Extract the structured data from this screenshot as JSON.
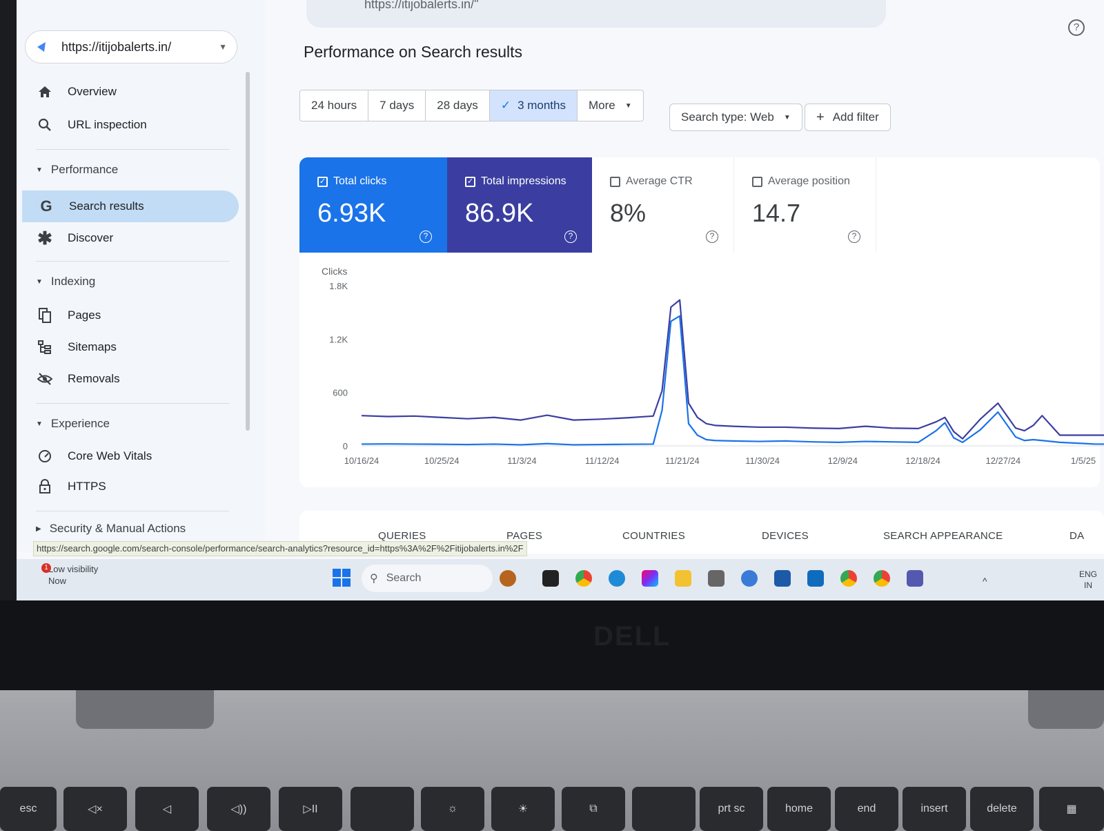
{
  "browser": {
    "address_fragment": "https://itijobalerts.in/\""
  },
  "property": {
    "url": "https://itijobalerts.in/"
  },
  "sidebar": {
    "overview": "Overview",
    "url_inspection": "URL inspection",
    "performance_header": "Performance",
    "search_results": "Search results",
    "discover": "Discover",
    "indexing_header": "Indexing",
    "pages": "Pages",
    "sitemaps": "Sitemaps",
    "removals": "Removals",
    "experience_header": "Experience",
    "core_web_vitals": "Core Web Vitals",
    "https": "HTTPS",
    "security_header": "Security & Manual Actions"
  },
  "main": {
    "title": "Performance on Search results",
    "ranges": [
      "24 hours",
      "7 days",
      "28 days",
      "3 months",
      "More"
    ],
    "selected_range": "3 months",
    "search_type": "Search type: Web",
    "add_filter": "Add filter"
  },
  "metrics": {
    "clicks": {
      "label": "Total clicks",
      "value": "6.93K",
      "checked": true
    },
    "impressions": {
      "label": "Total impressions",
      "value": "86.9K",
      "checked": true
    },
    "ctr": {
      "label": "Average CTR",
      "value": "8%",
      "checked": false
    },
    "position": {
      "label": "Average position",
      "value": "14.7",
      "checked": false
    }
  },
  "chart_data": {
    "type": "line",
    "ylabel": "Clicks",
    "ytick_labels": [
      "0",
      "600",
      "1.2K",
      "1.8K"
    ],
    "ylim": [
      0,
      1800
    ],
    "xtick_labels": [
      "10/16/24",
      "10/25/24",
      "11/3/24",
      "11/12/24",
      "11/21/24",
      "11/30/24",
      "12/9/24",
      "12/18/24",
      "12/27/24",
      "1/5/25"
    ],
    "x": [
      0,
      3,
      6,
      9,
      12,
      15,
      18,
      21,
      24,
      27,
      30,
      33,
      34,
      35,
      36,
      37,
      38,
      39,
      40,
      42,
      45,
      48,
      51,
      54,
      57,
      60,
      63,
      65,
      66,
      67,
      68,
      70,
      72,
      74,
      75,
      76,
      77,
      79,
      81,
      82,
      83,
      84
    ],
    "series": [
      {
        "color": "#3b3ea0",
        "values": [
          340,
          330,
          335,
          320,
          305,
          320,
          290,
          345,
          290,
          300,
          315,
          335,
          620,
          1560,
          1640,
          480,
          320,
          250,
          230,
          220,
          210,
          210,
          200,
          195,
          220,
          200,
          195,
          270,
          320,
          160,
          80,
          300,
          480,
          200,
          170,
          230,
          340,
          120,
          120,
          120,
          120,
          120
        ]
      },
      {
        "color": "#1a73e8",
        "values": [
          20,
          22,
          20,
          18,
          15,
          20,
          12,
          25,
          12,
          15,
          18,
          20,
          400,
          1400,
          1460,
          250,
          120,
          70,
          60,
          55,
          50,
          55,
          45,
          40,
          50,
          45,
          40,
          170,
          260,
          90,
          40,
          180,
          380,
          100,
          60,
          70,
          60,
          40,
          30,
          25,
          20,
          20
        ]
      }
    ]
  },
  "report_tabs": [
    "QUERIES",
    "PAGES",
    "COUNTRIES",
    "DEVICES",
    "SEARCH APPEARANCE",
    "DA"
  ],
  "status_url": "https://search.google.com/search-console/performance/search-analytics?resource_id=https%3A%2F%2Fitijobalerts.in%2F",
  "taskbar": {
    "notification_title": "Low visibility",
    "notification_time": "Now",
    "notification_count": "1",
    "search_placeholder": "Search",
    "lang_top": "ENG",
    "lang_bottom": "IN"
  },
  "keyboard": {
    "keys": [
      "esc",
      "prt sc",
      "home",
      "end",
      "insert",
      "delete"
    ]
  }
}
